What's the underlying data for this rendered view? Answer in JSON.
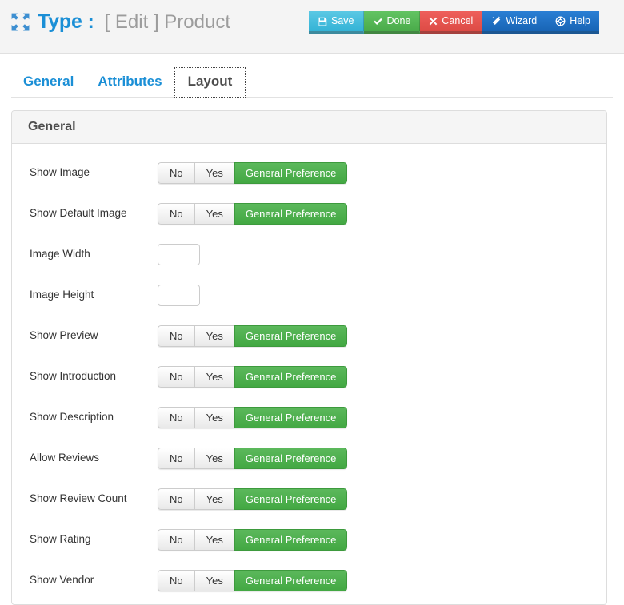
{
  "header": {
    "icon": "move-arrows-icon",
    "title": "Type :",
    "subtitle": "[ Edit ] Product",
    "title_color": "#1b8fd6",
    "subtitle_color": "#9c9c9c"
  },
  "toolbar": {
    "buttons": [
      {
        "label": "Save",
        "icon": "floppy-disk-icon",
        "color": "#3fbcdd"
      },
      {
        "label": "Done",
        "icon": "check-icon",
        "color": "#54b854"
      },
      {
        "label": "Cancel",
        "icon": "x-icon",
        "color": "#e4534e"
      },
      {
        "label": "Wizard",
        "icon": "magic-wand-icon",
        "color": "#1f72c4"
      },
      {
        "label": "Help",
        "icon": "life-ring-icon",
        "color": "#1f72c4"
      }
    ]
  },
  "tabs": [
    {
      "label": "General",
      "active": false
    },
    {
      "label": "Attributes",
      "active": false
    },
    {
      "label": "Layout",
      "active": true
    }
  ],
  "panel": {
    "title": "General",
    "toggle_options": [
      "No",
      "Yes",
      "General Preference"
    ],
    "active_option": "General Preference",
    "active_color": "#4ba84b",
    "rows": [
      {
        "label": "Show Image",
        "type": "toggle",
        "value": "General Preference"
      },
      {
        "label": "Show Default Image",
        "type": "toggle",
        "value": "General Preference"
      },
      {
        "label": "Image Width",
        "type": "input",
        "value": "",
        "placeholder": ""
      },
      {
        "label": "Image Height",
        "type": "input",
        "value": "",
        "placeholder": ""
      },
      {
        "label": "Show Preview",
        "type": "toggle",
        "value": "General Preference"
      },
      {
        "label": "Show Introduction",
        "type": "toggle",
        "value": "General Preference"
      },
      {
        "label": "Show Description",
        "type": "toggle",
        "value": "General Preference"
      },
      {
        "label": "Allow Reviews",
        "type": "toggle",
        "value": "General Preference"
      },
      {
        "label": "Show Review Count",
        "type": "toggle",
        "value": "General Preference"
      },
      {
        "label": "Show Rating",
        "type": "toggle",
        "value": "General Preference"
      },
      {
        "label": "Show Vendor",
        "type": "toggle",
        "value": "General Preference"
      }
    ]
  }
}
